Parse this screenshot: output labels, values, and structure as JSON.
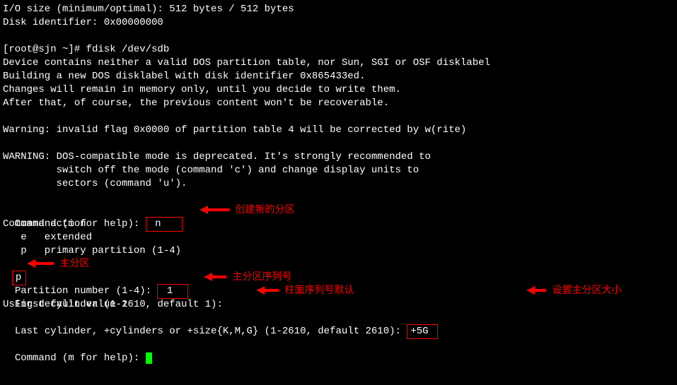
{
  "header": {
    "io_size": "I/O size (minimum/optimal): 512 bytes / 512 bytes",
    "disk_id": "Disk identifier: 0x00000000"
  },
  "prompt": {
    "shell": "[root@sjn ~]# fdisk /dev/sdb"
  },
  "msgs": {
    "line1": "Device contains neither a valid DOS partition table, nor Sun, SGI or OSF disklabel",
    "line2": "Building a new DOS disklabel with disk identifier 0x865433ed.",
    "line3": "Changes will remain in memory only, until you decide to write them.",
    "line4": "After that, of course, the previous content won't be recoverable.",
    "warn1": "Warning: invalid flag 0x0000 of partition table 4 will be corrected by w(rite)",
    "warn2a": "WARNING: DOS-compatible mode is deprecated. It's strongly recommended to",
    "warn2b": "         switch off the mode (command 'c') and change display units to",
    "warn2c": "         sectors (command 'u')."
  },
  "inter": {
    "cmd_prompt": "Command (m for help): ",
    "cmd_n": "n",
    "cmd_action": "Command action",
    "act_e": "   e   extended",
    "act_p": "   p   primary partition (1-4)",
    "input_p": "p",
    "part_num_prompt": "Partition number (1-4): ",
    "part_num": "1",
    "first_cyl": "First cylinder (1-2610, default 1): ",
    "using_default": "Using default value 1",
    "last_cyl": "Last cylinder, +cylinders or +size{K,M,G} (1-2610, default 2610): ",
    "last_input": "+5G",
    "cmd_prompt2": "Command (m for help): "
  },
  "annot": {
    "create_new": "创建新的分区",
    "primary": "主分区",
    "primary_seq": "主分区序列号",
    "cylinder_default": "柱面序列号默认",
    "set_size": "设置主分区大小"
  }
}
